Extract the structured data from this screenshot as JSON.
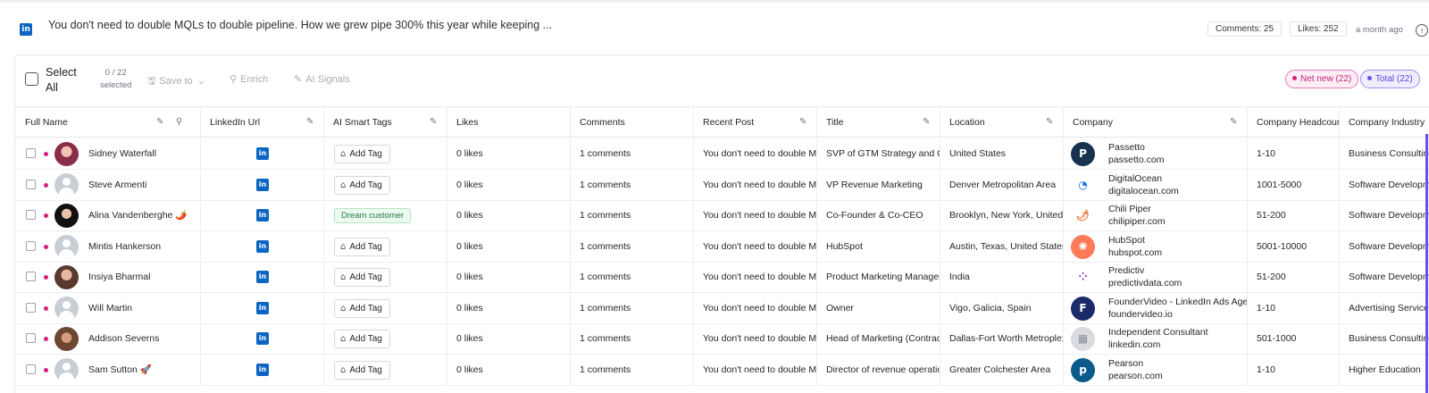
{
  "post": {
    "icon": "linkedin-icon",
    "text": "You don't need to double MQLs to double pipeline. How we grew pipe 300% this year while keeping ...",
    "comments": "Comments: 25",
    "likes": "Likes: 252",
    "time": "a month ago"
  },
  "toolbar": {
    "select_all": "Select All",
    "count_top": "0 / 22",
    "count_bottom": "selected",
    "save_to": "Save to",
    "enrich": "Enrich",
    "ai_signals": "AI Signals",
    "net_new": "Net new (22)",
    "total": "Total (22)"
  },
  "columns": {
    "full_name": "Full Name",
    "linkedin_url": "LinkedIn Url",
    "ai_smart_tags": "AI Smart Tags",
    "likes": "Likes",
    "comments": "Comments",
    "recent_post": "Recent Post",
    "title": "Title",
    "location": "Location",
    "company": "Company",
    "headcount": "Company Headcount",
    "industry": "Company Industry"
  },
  "rows": [
    {
      "name": "Sidney Waterfall",
      "tag": "Add Tag",
      "likes": "0 likes",
      "comments": "1 comments",
      "post": "You don't need to double MQLs",
      "title": "SVP of GTM Strategy and Co",
      "location": "United States",
      "company": "Passetto",
      "domain": "passetto.com",
      "headcount": "1-10",
      "industry": "Business Consulting"
    },
    {
      "name": "Steve Armenti",
      "tag": "Add Tag",
      "likes": "0 likes",
      "comments": "1 comments",
      "post": "You don't need to double MQLs",
      "title": "VP Revenue Marketing",
      "location": "Denver Metropolitan Area",
      "company": "DigitalOcean",
      "domain": "digitalocean.com",
      "headcount": "1001-5000",
      "industry": "Software Development"
    },
    {
      "name": "Alina Vandenberghe 🌶️",
      "tag": "Dream customer",
      "likes": "0 likes",
      "comments": "1 comments",
      "post": "You don't need to double MQLs",
      "title": "Co-Founder & Co-CEO",
      "location": "Brooklyn, New York, United States",
      "company": "Chili Piper",
      "domain": "chilipiper.com",
      "headcount": "51-200",
      "industry": "Software Development"
    },
    {
      "name": "Mintis Hankerson",
      "tag": "Add Tag",
      "likes": "0 likes",
      "comments": "1 comments",
      "post": "You don't need to double MQLs",
      "title": "HubSpot",
      "location": "Austin, Texas, United States",
      "company": "HubSpot",
      "domain": "hubspot.com",
      "headcount": "5001-10000",
      "industry": "Software Development"
    },
    {
      "name": "Insiya Bharmal",
      "tag": "Add Tag",
      "likes": "0 likes",
      "comments": "1 comments",
      "post": "You don't need to double MQLs",
      "title": "Product Marketing Manager",
      "location": "India",
      "company": "Predictiv",
      "domain": "predictivdata.com",
      "headcount": "51-200",
      "industry": "Software Development"
    },
    {
      "name": "Will Martin",
      "tag": "Add Tag",
      "likes": "0 likes",
      "comments": "1 comments",
      "post": "You don't need to double MQLs",
      "title": "Owner",
      "location": "Vigo, Galicia, Spain",
      "company": "FounderVideo - LinkedIn Ads Agency",
      "domain": "foundervideo.io",
      "headcount": "1-10",
      "industry": "Advertising Services"
    },
    {
      "name": "Addison Severns",
      "tag": "Add Tag",
      "likes": "0 likes",
      "comments": "1 comments",
      "post": "You don't need to double MQLs",
      "title": "Head of Marketing (Contract)",
      "location": "Dallas-Fort Worth Metroplex",
      "company": "Independent Consultant",
      "domain": "linkedin.com",
      "headcount": "501-1000",
      "industry": "Business Consulting"
    },
    {
      "name": "Sam Sutton 🚀",
      "tag": "Add Tag",
      "likes": "0 likes",
      "comments": "1 comments",
      "post": "You don't need to double MQLs",
      "title": "Director of revenue operations",
      "location": "Greater Colchester Area",
      "company": "Pearson",
      "domain": "pearson.com",
      "headcount": "1-10",
      "industry": "Higher Education"
    }
  ],
  "colors": {
    "accent_purple": "#6a4fe6",
    "net_new_pink": "#d6217a",
    "linkedin_blue": "#0a66c2"
  }
}
